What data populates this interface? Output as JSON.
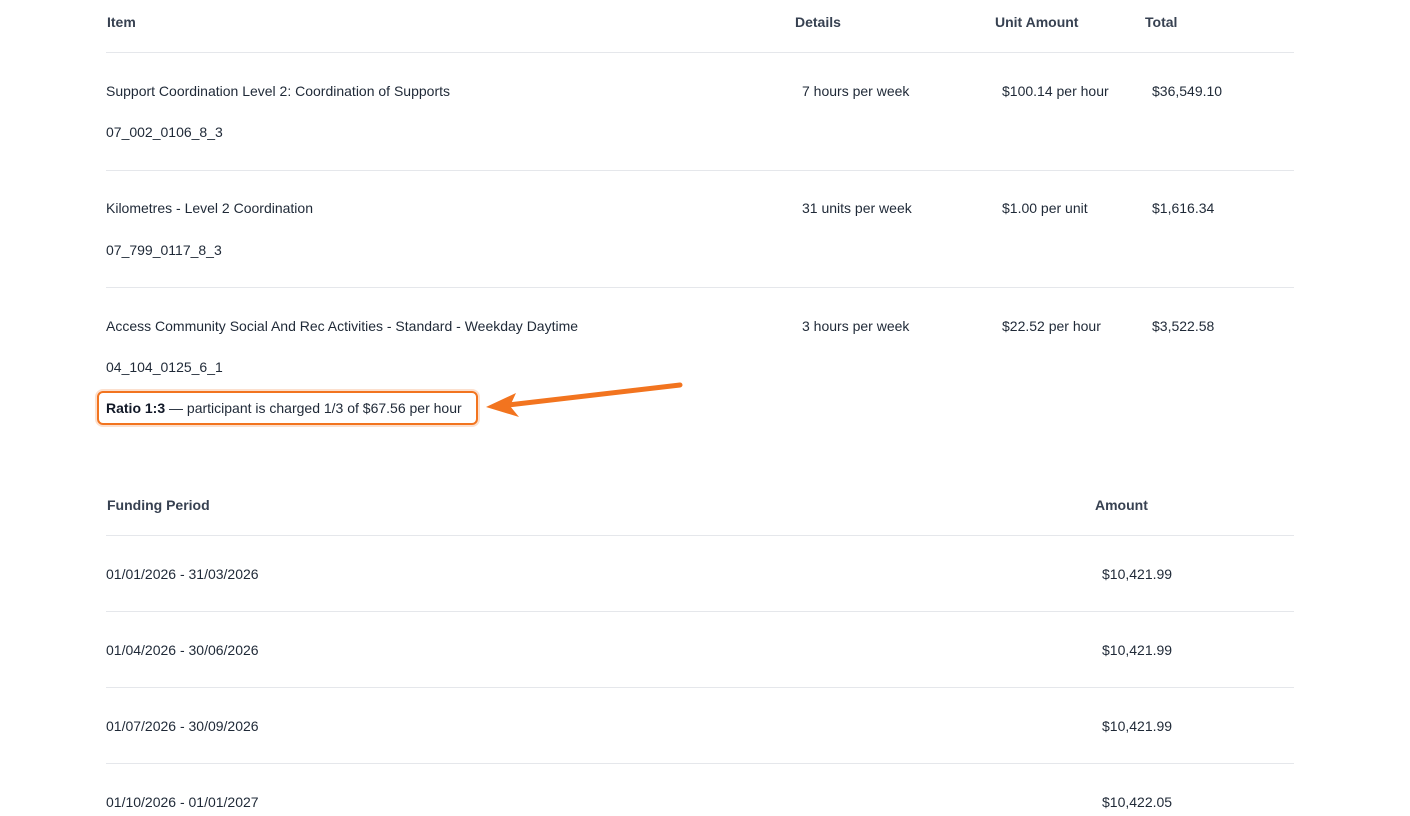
{
  "items_table": {
    "headers": {
      "item": "Item",
      "details": "Details",
      "unit_amount": "Unit Amount",
      "total": "Total"
    },
    "rows": [
      {
        "name": "Support Coordination Level 2: Coordination of Supports",
        "code": "07_002_0106_8_3",
        "details": "7 hours per week",
        "unit_amount": "$100.14 per hour",
        "total": "$36,549.10"
      },
      {
        "name": "Kilometres - Level 2 Coordination",
        "code": "07_799_0117_8_3",
        "details": "31 units per week",
        "unit_amount": "$1.00 per unit",
        "total": "$1,616.34"
      },
      {
        "name": "Access Community Social And Rec Activities - Standard - Weekday Daytime",
        "code": "04_104_0125_6_1",
        "details": "3 hours per week",
        "unit_amount": "$22.52 per hour",
        "total": "$3,522.58"
      }
    ],
    "ratio_note": {
      "label": "Ratio 1:3",
      "text": " — participant is charged 1/3 of $67.56 per hour"
    }
  },
  "funding_table": {
    "headers": {
      "period": "Funding Period",
      "amount": "Amount"
    },
    "rows": [
      {
        "period": "01/01/2026 - 31/03/2026",
        "amount": "$10,421.99"
      },
      {
        "period": "01/04/2026 - 30/06/2026",
        "amount": "$10,421.99"
      },
      {
        "period": "01/07/2026 - 30/09/2026",
        "amount": "$10,421.99"
      },
      {
        "period": "01/10/2026 - 01/01/2027",
        "amount": "$10,422.05"
      }
    ]
  },
  "colors": {
    "highlight": "#f2741f",
    "divider": "#e5e7eb",
    "text": "#1f2937"
  },
  "icons": {
    "callout": "arrow-left-icon"
  }
}
